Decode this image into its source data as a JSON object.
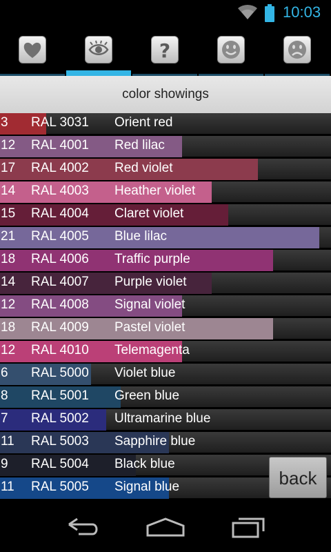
{
  "status": {
    "time": "10:03",
    "accent": "#33b5e5"
  },
  "tabs": [
    {
      "icon": "heart-icon",
      "active": false
    },
    {
      "icon": "eye-icon",
      "active": true
    },
    {
      "icon": "question-icon",
      "active": false
    },
    {
      "icon": "smile-icon",
      "active": false
    },
    {
      "icon": "sad-icon",
      "active": false
    }
  ],
  "header": {
    "title": "color showings"
  },
  "rows": [
    {
      "count": "3",
      "code": "RAL 3031",
      "name": "Orient red",
      "color": "#a12b32",
      "fraction": 0.14
    },
    {
      "count": "12",
      "code": "RAL 4001",
      "name": "Red lilac",
      "color": "#845a85",
      "fraction": 0.55
    },
    {
      "count": "17",
      "code": "RAL 4002",
      "name": "Red violet",
      "color": "#8c3b4d",
      "fraction": 0.78
    },
    {
      "count": "14",
      "code": "RAL 4003",
      "name": "Heather violet",
      "color": "#c4608c",
      "fraction": 0.64
    },
    {
      "count": "15",
      "code": "RAL 4004",
      "name": "Claret violet",
      "color": "#651e38",
      "fraction": 0.69
    },
    {
      "count": "21",
      "code": "RAL 4005",
      "name": "Blue lilac",
      "color": "#76689a",
      "fraction": 0.965
    },
    {
      "count": "18",
      "code": "RAL 4006",
      "name": "Traffic purple",
      "color": "#903373",
      "fraction": 0.825
    },
    {
      "count": "14",
      "code": "RAL 4007",
      "name": "Purple violet",
      "color": "#47243c",
      "fraction": 0.64
    },
    {
      "count": "12",
      "code": "RAL 4008",
      "name": "Signal violet",
      "color": "#844c82",
      "fraction": 0.55
    },
    {
      "count": "18",
      "code": "RAL 4009",
      "name": "Pastel violet",
      "color": "#9d8692",
      "fraction": 0.825
    },
    {
      "count": "12",
      "code": "RAL 4010",
      "name": "Telemagenta",
      "color": "#bb4077",
      "fraction": 0.55
    },
    {
      "count": "6",
      "code": "RAL 5000",
      "name": "Violet blue",
      "color": "#344f6e",
      "fraction": 0.275
    },
    {
      "count": "8",
      "code": "RAL 5001",
      "name": "Green blue",
      "color": "#1f4764",
      "fraction": 0.365
    },
    {
      "count": "7",
      "code": "RAL 5002",
      "name": "Ultramarine blue",
      "color": "#2b2c7c",
      "fraction": 0.32
    },
    {
      "count": "11",
      "code": "RAL 5003",
      "name": "Sapphire blue",
      "color": "#2a3756",
      "fraction": 0.51
    },
    {
      "count": "9",
      "code": "RAL 5004",
      "name": "Black blue",
      "color": "#1d1f2a",
      "fraction": 0.41
    },
    {
      "count": "11",
      "code": "RAL 5005",
      "name": "Signal blue",
      "color": "#154889",
      "fraction": 0.51
    }
  ],
  "back_label": "back",
  "nav": [
    {
      "icon": "back-arrow-icon"
    },
    {
      "icon": "home-icon"
    },
    {
      "icon": "recent-apps-icon"
    }
  ]
}
